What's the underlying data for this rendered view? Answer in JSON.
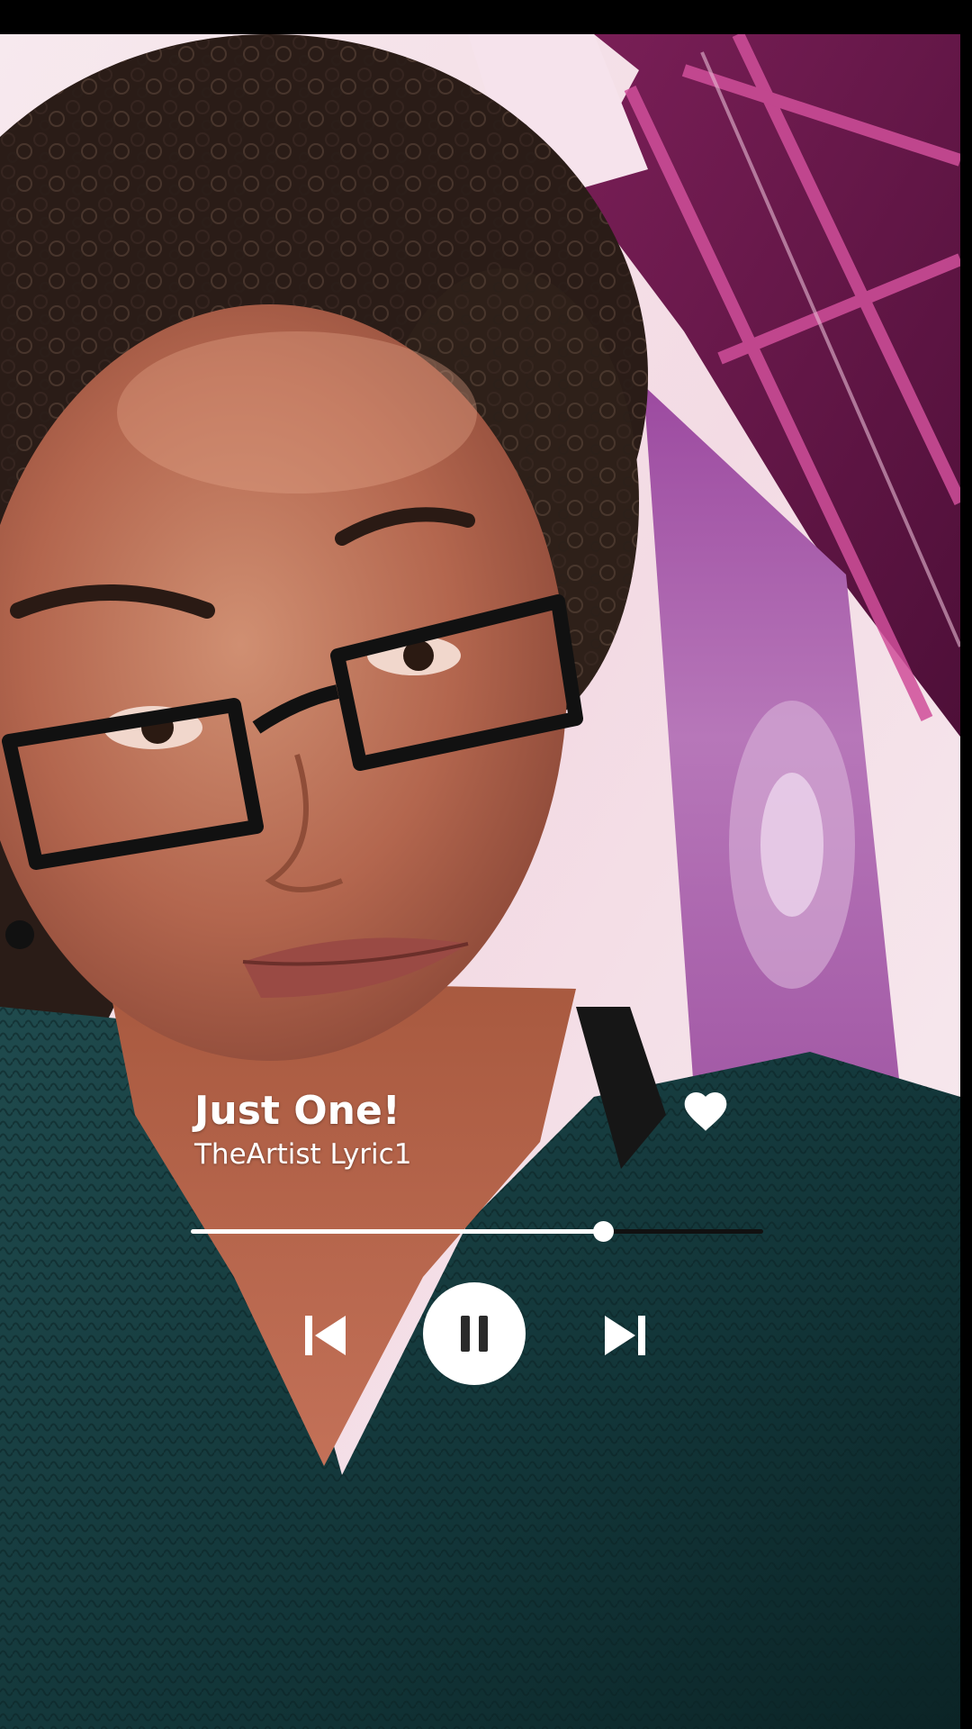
{
  "player": {
    "title": "Just One!",
    "artist": "TheArtist Lyric1",
    "progress_fraction": 0.72,
    "liked": true,
    "state": "playing"
  },
  "icons": {
    "like": "heart-icon",
    "previous": "skip-previous-icon",
    "pause": "pause-icon",
    "next": "skip-next-icon"
  },
  "colors": {
    "controls": "#ffffff",
    "progress_remaining": "#111111",
    "pause_glyph": "#2a2a2a"
  }
}
